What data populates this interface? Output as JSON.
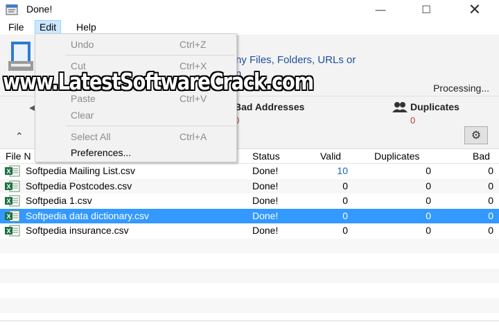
{
  "window": {
    "title": "Done!",
    "minimize": "—",
    "maximize": "☐",
    "close": "✕"
  },
  "menubar": {
    "file": "File",
    "edit": "Edit",
    "help": "Help"
  },
  "edit_menu": {
    "undo": "Undo",
    "undo_shortcut": "Ctrl+Z",
    "cut": "Cut",
    "cut_shortcut": "Ctrl+X",
    "paste": "Paste",
    "paste_shortcut": "Ctrl+V",
    "clear": "Clear",
    "select_all": "Select All",
    "select_all_shortcut": "Ctrl+A",
    "preferences": "Preferences..."
  },
  "top_panel": {
    "drop_text_line1": "ny Files, Folders, URLs or",
    "drop_text_line2": "n",
    "processing": "Processing...",
    "bad_label": "Bad Addresses",
    "bad_value": "0",
    "dup_label": "Duplicates",
    "dup_value": "0",
    "collapse_icon": "⌃",
    "gear_icon": "⚙"
  },
  "table": {
    "headers": {
      "file": "File N",
      "status": "Status",
      "valid": "Valid",
      "duplicates": "Duplicates",
      "bad": "Bad"
    },
    "rows": [
      {
        "name": "Softpedia Mailing List.csv",
        "status": "Done!",
        "valid": "10",
        "duplicates": "0",
        "bad": "0"
      },
      {
        "name": "Softpedia Postcodes.csv",
        "status": "Done!",
        "valid": "0",
        "duplicates": "0",
        "bad": "0"
      },
      {
        "name": "Softpedia 1.csv",
        "status": "Done!",
        "valid": "0",
        "duplicates": "0",
        "bad": "0"
      },
      {
        "name": "Softpedia data dictionary.csv",
        "status": "Done!",
        "valid": "0",
        "duplicates": "0",
        "bad": "0"
      },
      {
        "name": "Softpedia insurance.csv",
        "status": "Done!",
        "valid": "0",
        "duplicates": "0",
        "bad": "0"
      }
    ],
    "selected_index": 3
  },
  "watermark": "www.LatestSoftwareCrack.com",
  "colors": {
    "selection": "#3399ff",
    "link_blue": "#1f4e9c",
    "count_red": "#c0392b",
    "menu_highlight": "#cce8ff"
  }
}
